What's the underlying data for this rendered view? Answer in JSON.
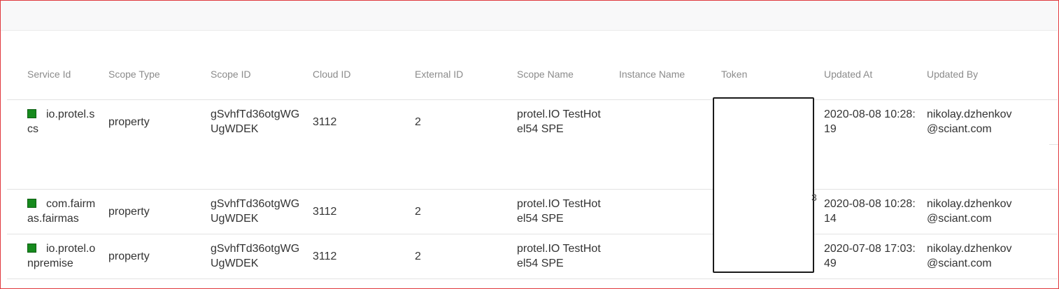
{
  "columns": {
    "service_id": "Service Id",
    "scope_type": "Scope Type",
    "scope_id": "Scope ID",
    "cloud_id": "Cloud ID",
    "external_id": "External ID",
    "scope_name": "Scope Name",
    "instance_name": "Instance Name",
    "token": "Token",
    "updated_at": "Updated At",
    "updated_by": "Updated By"
  },
  "rows": [
    {
      "service_l1": "io.protel.s",
      "service_l2": "cs",
      "scope_type": "property",
      "scope_id_l1": "gSvhfTd36otgWG",
      "scope_id_l2": "UgWDEK",
      "cloud_id": "3112",
      "external_id": "2",
      "scope_name_l1": "protel.IO TestHot",
      "scope_name_l2": "el54 SPE",
      "updated_at_l1": "2020-08-08 10:28:",
      "updated_at_l2": "19",
      "updated_by_l1": "nikolay.dzhenkov",
      "updated_by_l2": "@sciant.com"
    },
    {
      "service_l1": "com.fairm",
      "service_l2": "as.fairmas",
      "scope_type": "property",
      "scope_id_l1": "gSvhfTd36otgWG",
      "scope_id_l2": "UgWDEK",
      "cloud_id": "3112",
      "external_id": "2",
      "scope_name_l1": "protel.IO TestHot",
      "scope_name_l2": "el54 SPE",
      "updated_at_l1": "2020-08-08 10:28:",
      "updated_at_l2": "14",
      "updated_by_l1": "nikolay.dzhenkov",
      "updated_by_l2": "@sciant.com"
    },
    {
      "service_l1": "io.protel.o",
      "service_l2": "npremise",
      "scope_type": "property",
      "scope_id_l1": "gSvhfTd36otgWG",
      "scope_id_l2": "UgWDEK",
      "cloud_id": "3112",
      "external_id": "2",
      "scope_name_l1": "protel.IO TestHot",
      "scope_name_l2": "el54 SPE",
      "updated_at_l1": "2020-07-08 17:03:",
      "updated_at_l2": "49",
      "updated_by_l1": "nikolay.dzhenkov",
      "updated_by_l2": "@sciant.com"
    }
  ],
  "status_color": "#168a1d",
  "status_icon": "green-square-icon"
}
